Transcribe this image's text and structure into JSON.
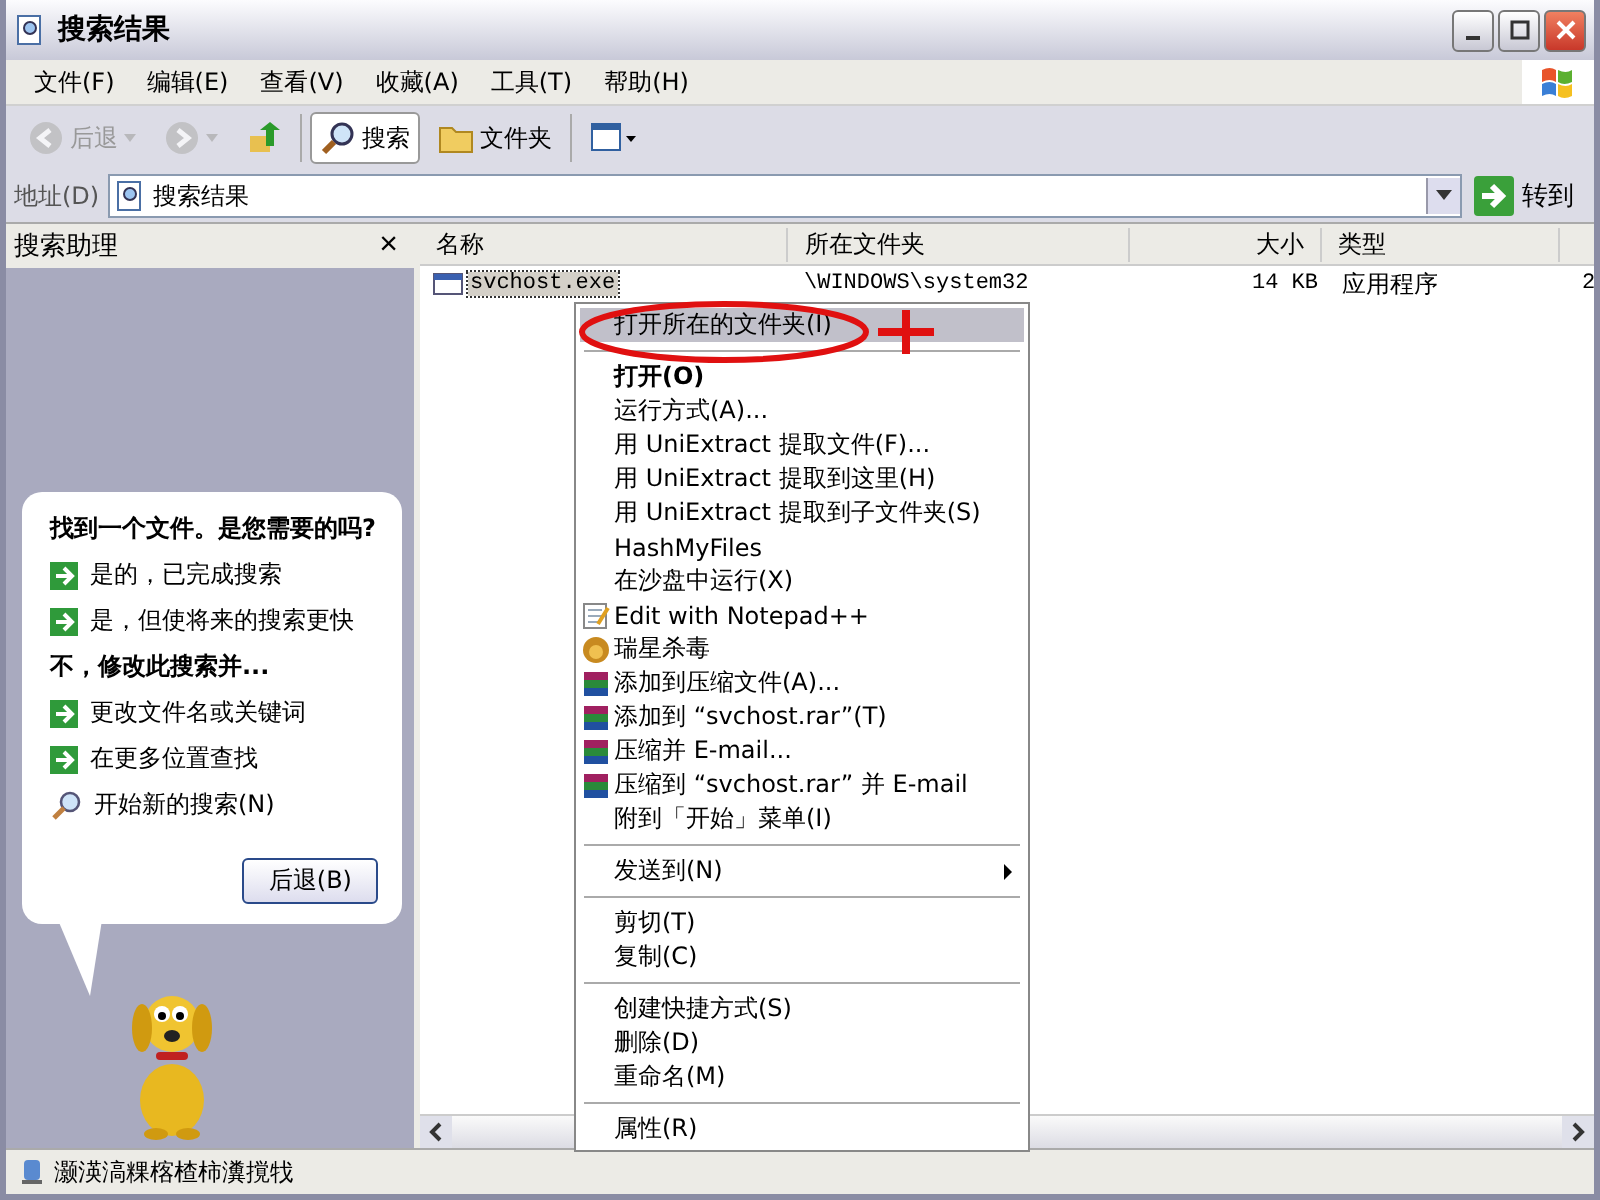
{
  "window": {
    "title": "搜索结果"
  },
  "menu": [
    "文件(F)",
    "编辑(E)",
    "查看(V)",
    "收藏(A)",
    "工具(T)",
    "帮助(H)"
  ],
  "toolbar": [
    {
      "kind": "back",
      "label": "后退",
      "disabled": true,
      "selected": false
    },
    {
      "kind": "forward",
      "disabled": true,
      "selected": false
    },
    {
      "kind": "up",
      "disabled": false,
      "selected": false
    },
    {
      "kind": "search",
      "label": "搜索",
      "disabled": false,
      "selected": true
    },
    {
      "kind": "folders",
      "label": "文件夹",
      "disabled": false,
      "selected": false
    },
    {
      "kind": "views",
      "disabled": false,
      "selected": false
    }
  ],
  "address": {
    "label": "地址(D)",
    "value": "搜索结果",
    "go": "转到"
  },
  "search_pane": {
    "title": "搜索助理",
    "close": "×",
    "heading": "找到一个文件。是您需要的吗?",
    "items": [
      {
        "kind": "link",
        "text": "是的，已完成搜索"
      },
      {
        "kind": "link",
        "text": "是，但使将来的搜索更快"
      },
      {
        "kind": "heading",
        "text": "不，修改此搜索并..."
      },
      {
        "kind": "link",
        "text": "更改文件名或关键词"
      },
      {
        "kind": "link",
        "text": "在更多位置查找"
      },
      {
        "kind": "search",
        "text": "开始新的搜索(N)"
      }
    ],
    "button": "后退(B)"
  },
  "table": {
    "columns": [
      "名称",
      "所在文件夹",
      "大小",
      "类型",
      ""
    ],
    "rows": [
      {
        "name": "svchost.exe",
        "folder": "\\WINDOWS\\system32",
        "size": "14 KB",
        "type": "应用程序",
        "column_5": "2",
        "selected": true
      }
    ]
  },
  "context_menu": [
    {
      "kind": "item",
      "text": "打开所在的文件夹(I)",
      "selected": true,
      "bold": false
    },
    {
      "kind": "separator"
    },
    {
      "kind": "item",
      "text": "打开(O)",
      "selected": false,
      "bold": true
    },
    {
      "kind": "item",
      "text": "运行方式(A)...",
      "selected": false,
      "bold": false
    },
    {
      "kind": "item",
      "text": "用 UniExtract 提取文件(F)...",
      "selected": false,
      "bold": false
    },
    {
      "kind": "item",
      "text": "用 UniExtract 提取到这里(H)",
      "selected": false,
      "bold": false
    },
    {
      "kind": "item",
      "text": "用 UniExtract 提取到子文件夹(S)",
      "selected": false,
      "bold": false
    },
    {
      "kind": "item",
      "text": "HashMyFiles",
      "selected": false,
      "bold": false
    },
    {
      "kind": "item",
      "text": "在沙盘中运行(X)",
      "selected": false,
      "bold": false
    },
    {
      "kind": "notepad",
      "text": "Edit with Notepad++",
      "selected": false,
      "bold": false
    },
    {
      "kind": "antivirus",
      "text": "瑞星杀毒",
      "selected": false,
      "bold": false
    },
    {
      "kind": "archive",
      "text": "添加到压缩文件(A)...",
      "selected": false,
      "bold": false
    },
    {
      "kind": "archive",
      "text": "添加到 “svchost.rar”(T)",
      "selected": false,
      "bold": false
    },
    {
      "kind": "archive",
      "text": "压缩并 E-mail...",
      "selected": false,
      "bold": false
    },
    {
      "kind": "archive",
      "text": "压缩到 “svchost.rar” 并 E-mail",
      "selected": false,
      "bold": false
    },
    {
      "kind": "item",
      "text": "附到「开始」菜单(I)",
      "selected": false,
      "bold": false
    },
    {
      "kind": "separator"
    },
    {
      "kind": "submenu",
      "text": "发送到(N)",
      "selected": false,
      "bold": false
    },
    {
      "kind": "separator"
    },
    {
      "kind": "item",
      "text": "剪切(T)",
      "selected": false,
      "bold": false
    },
    {
      "kind": "item",
      "text": "复制(C)",
      "selected": false,
      "bold": false
    },
    {
      "kind": "separator"
    },
    {
      "kind": "item",
      "text": "创建快捷方式(S)",
      "selected": false,
      "bold": false
    },
    {
      "kind": "item",
      "text": "删除(D)",
      "selected": false,
      "bold": false
    },
    {
      "kind": "item",
      "text": "重命名(M)",
      "selected": false,
      "bold": false
    },
    {
      "kind": "separator"
    },
    {
      "kind": "item",
      "text": "属性(R)",
      "selected": false,
      "bold": false
    }
  ],
  "status_bar": "灏渶滈粿楁楂柿瀵撹牫"
}
